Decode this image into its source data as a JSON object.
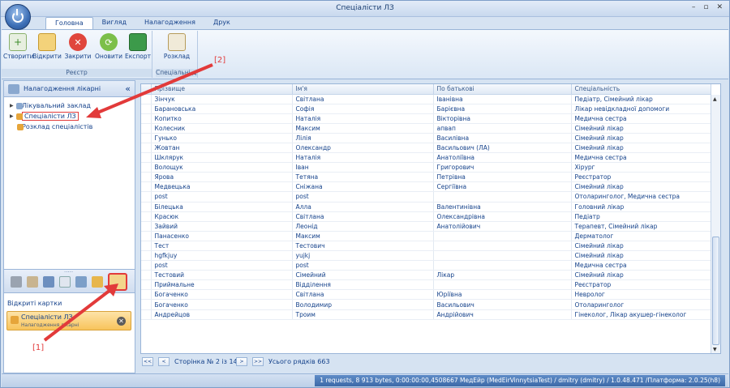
{
  "window": {
    "title": "Спеціалісти ЛЗ",
    "controls": [
      "–",
      "▫",
      "✕"
    ]
  },
  "tabs": [
    "Головна",
    "Вигляд",
    "Налагодження",
    "Друк"
  ],
  "ribbon": {
    "group1": {
      "label": "Реєстр",
      "buttons": [
        "Створити",
        "Відкрити",
        "Закрити",
        "Оновити",
        "Експорт"
      ]
    },
    "group2": {
      "label": "Спеціальні ді",
      "buttons": [
        "Розклад"
      ]
    }
  },
  "left_panel": {
    "title": "Налагодження лікарні",
    "tree": [
      "Лікувальний заклад",
      "Спеціалісти ЛЗ",
      "Розклад спеціалістів"
    ],
    "open_cards_title": "Відкриті картки",
    "card": {
      "title": "Спеціалісти ЛЗ",
      "subtitle": "Налагодження лікарні"
    }
  },
  "grid": {
    "columns": [
      "Прізвище",
      "Ім'я",
      "По батькові",
      "Спеціальність"
    ],
    "rows": [
      [
        "Зінчук",
        "Світлана",
        "Іванівна",
        "Педіатр, Сімейний лікар"
      ],
      [
        "Барановська",
        "Софія",
        "Барієвна",
        "Лікар невідкладної допомоги"
      ],
      [
        "Копитко",
        "Наталія",
        "Вікторівна",
        "Медична сестра"
      ],
      [
        "Колесник",
        "Максим",
        "апвап",
        "Сімейний лікар"
      ],
      [
        "Гунько",
        "Лілія",
        "Василівна",
        "Сімейний лікар"
      ],
      [
        "Жовтан",
        "Олександр",
        "Васильович (ЛА)",
        "Сімейний лікар"
      ],
      [
        "Шклярук",
        "Наталія",
        "Анатоліївна",
        "Медична сестра"
      ],
      [
        "Волощук",
        "Іван",
        "Григорович",
        "Хірург"
      ],
      [
        "Ярова",
        "Тетяна",
        "Петрівна",
        "Реєстратор"
      ],
      [
        "Медвецька",
        "Сніжана",
        "Сергіївна",
        "Сімейний лікар"
      ],
      [
        "post",
        "post",
        "",
        "Отоларинголог, Медична сестра"
      ],
      [
        "Білецька",
        "Алла",
        "Валентинівна",
        "Головний лікар"
      ],
      [
        "Красюк",
        "Світлана",
        "Олександрівна",
        "Педіатр"
      ],
      [
        "Зайвий",
        "Леонід",
        "Анатолійович",
        "Терапевт, Сімейний лікар"
      ],
      [
        "Панасенко",
        "Максим",
        "",
        "Дерматолог"
      ],
      [
        "Тест",
        "Тестович",
        "",
        "Сімейний лікар"
      ],
      [
        "hgfkjuy",
        "yujkj",
        "",
        "Сімейний лікар"
      ],
      [
        "post",
        "post",
        "",
        "Медична сестра"
      ],
      [
        "Тестовий",
        "Сімейний",
        "Лікар",
        "Сімейний лікар"
      ],
      [
        "Приймальне",
        "Відділення",
        "",
        "Реєстратор"
      ],
      [
        "Богаченко",
        "Світлана",
        "Юріївна",
        "Невролог"
      ],
      [
        "Богаченко",
        "Володимир",
        "Васильович",
        "Отоларинголог"
      ],
      [
        "Андрейцов",
        "Троим",
        "Андрійович",
        "Гінеколог, Лікар акушер-гінеколог"
      ]
    ]
  },
  "pager": {
    "first": "<<",
    "prev": "<",
    "page_text": "Сторінка № 2 із 14",
    "next": ">",
    "last": ">>",
    "total": "Усього рядків 663"
  },
  "status": {
    "text": "1 requests, 8 913 bytes, 0:00:00:00,4508667  МедЕйр (MedEirVinnytsiaTest) / dmitry (dmitry) / 1.0.48.471 /Платформа: 2.0.25(h8)"
  },
  "annotations": {
    "a1": "[1]",
    "a2": "[2]"
  },
  "colors": {
    "accent": "#15428b",
    "highlight": "#e23a3a",
    "card": "#f8c45b"
  }
}
